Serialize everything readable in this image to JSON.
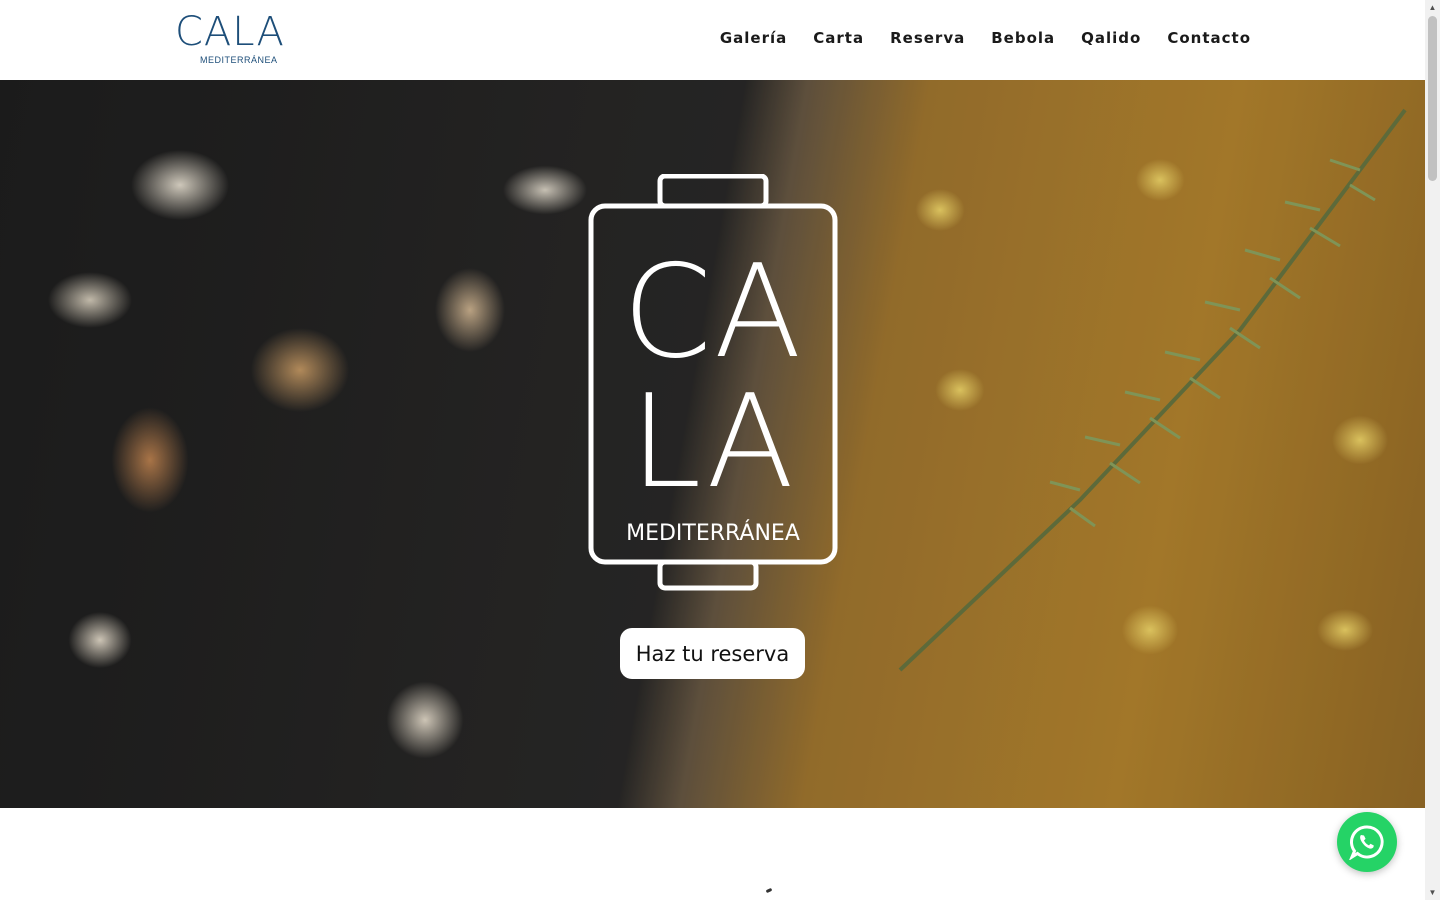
{
  "header": {
    "logo_main": "CALA",
    "logo_sub": "MEDITERRÁNEA",
    "nav": [
      "Galería",
      "Carta",
      "Reserva",
      "Bebola",
      "Qalido",
      "Contacto"
    ]
  },
  "hero": {
    "logo_text_top": "CA",
    "logo_text_bottom": "LA",
    "logo_sub": "MEDITERRÁNEA",
    "cta_label": "Haz tu reserva"
  },
  "colors": {
    "brand_blue": "#1d4e79",
    "whatsapp_green": "#25d366"
  },
  "icons": {
    "chat_widget": "whatsapp-icon"
  }
}
